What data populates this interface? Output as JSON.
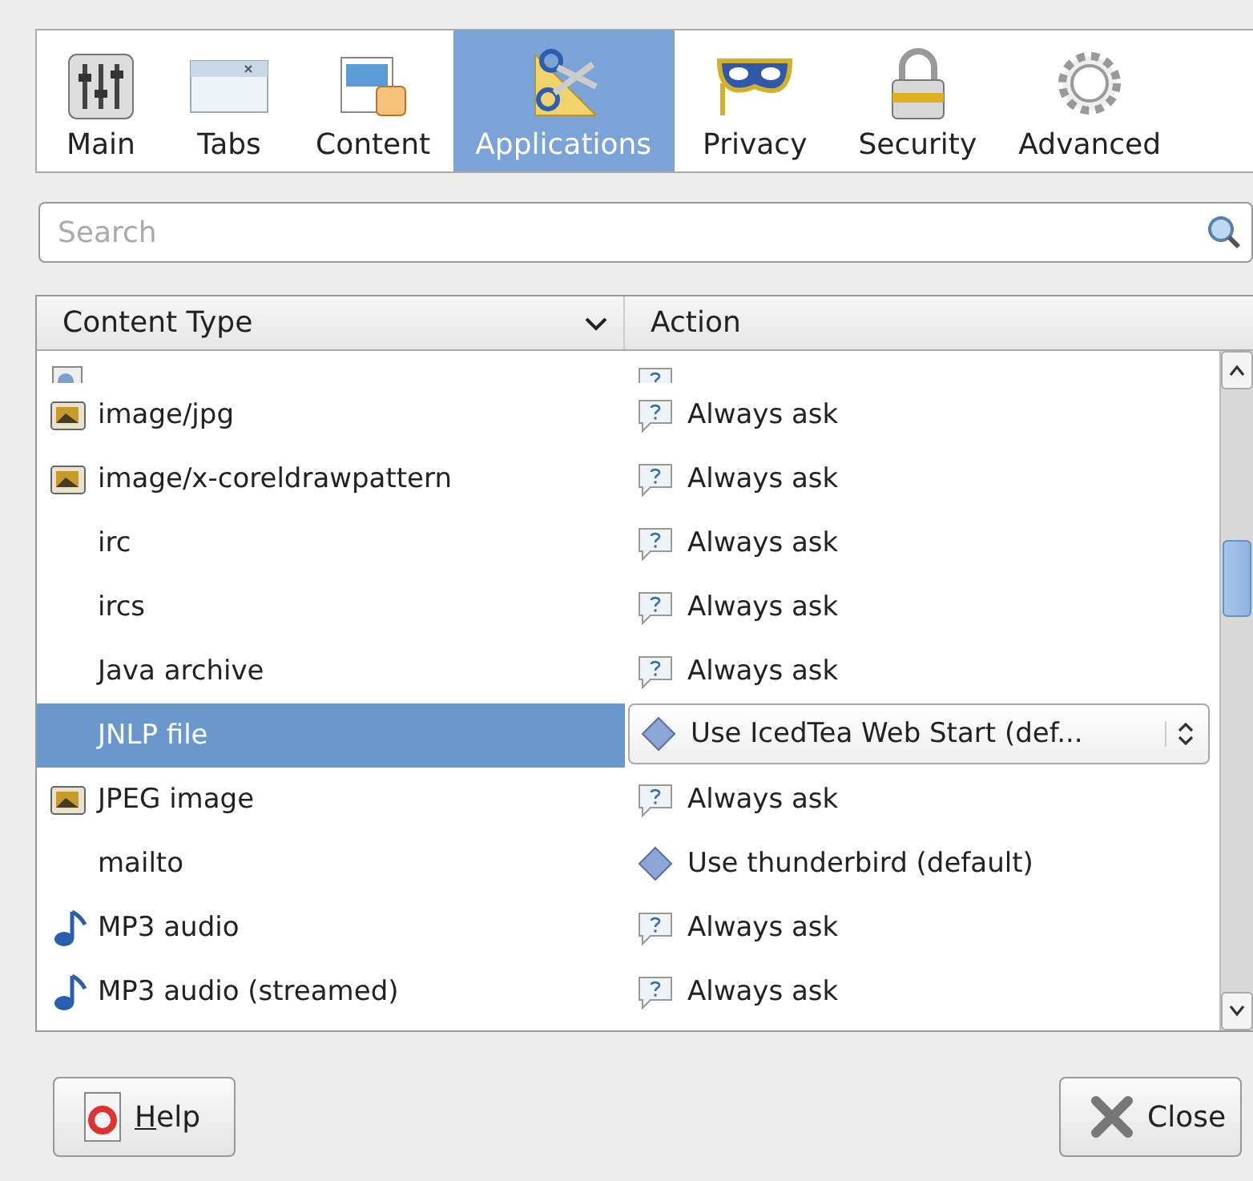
{
  "tabs": [
    {
      "label": "Main",
      "selected": false
    },
    {
      "label": "Tabs",
      "selected": false
    },
    {
      "label": "Content",
      "selected": false
    },
    {
      "label": "Applications",
      "selected": true
    },
    {
      "label": "Privacy",
      "selected": false
    },
    {
      "label": "Security",
      "selected": false
    },
    {
      "label": "Advanced",
      "selected": false
    }
  ],
  "search": {
    "placeholder": "Search"
  },
  "table": {
    "columns": [
      "Content Type",
      "Action"
    ],
    "rows": [
      {
        "kind": "html",
        "action": {
          "kind": "ask"
        },
        "selected": false,
        "partial": true
      },
      {
        "kind": "image",
        "type": "image/jpg",
        "action": {
          "kind": "ask",
          "label": "Always ask"
        },
        "selected": false,
        "partial": false
      },
      {
        "kind": "image",
        "type": "image/x-coreldrawpattern",
        "action": {
          "kind": "ask",
          "label": "Always ask"
        },
        "selected": false,
        "partial": false
      },
      {
        "kind": "plain",
        "type": "irc",
        "action": {
          "kind": "ask",
          "label": "Always ask"
        },
        "selected": false,
        "partial": false
      },
      {
        "kind": "plain",
        "type": "ircs",
        "action": {
          "kind": "ask",
          "label": "Always ask"
        },
        "selected": false,
        "partial": false
      },
      {
        "kind": "plain",
        "type": "Java archive",
        "action": {
          "kind": "ask",
          "label": "Always ask"
        },
        "selected": false,
        "partial": false
      },
      {
        "kind": "plain",
        "type": "JNLP file",
        "action": {
          "kind": "app",
          "label": "Use IcedTea Web Start (def..."
        },
        "selected": true,
        "partial": false
      },
      {
        "kind": "image",
        "type": "JPEG image",
        "action": {
          "kind": "ask",
          "label": "Always ask"
        },
        "selected": false,
        "partial": false
      },
      {
        "kind": "plain",
        "type": "mailto",
        "action": {
          "kind": "app",
          "label": "Use thunderbird (default)"
        },
        "selected": false,
        "partial": false
      },
      {
        "kind": "audio",
        "type": "MP3 audio",
        "action": {
          "kind": "ask",
          "label": "Always ask"
        },
        "selected": false,
        "partial": false
      },
      {
        "kind": "audio",
        "type": "MP3 audio (streamed)",
        "action": {
          "kind": "ask",
          "label": "Always ask"
        },
        "selected": false,
        "partial": false
      }
    ]
  },
  "buttons": [
    {
      "kind": "help",
      "label": "Help",
      "mnemonic": true
    },
    {
      "kind": "close",
      "label": "Close"
    }
  ]
}
